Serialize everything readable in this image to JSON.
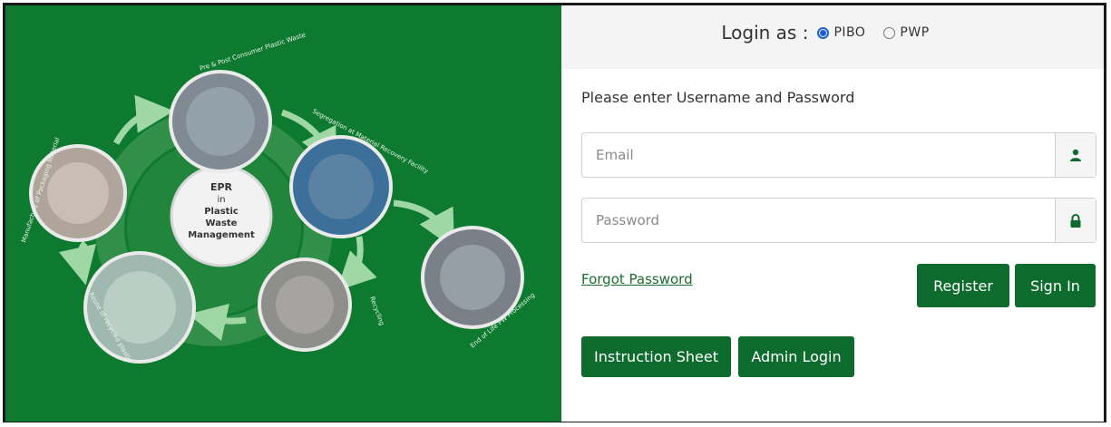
{
  "login_as": {
    "label": "Login as :",
    "options": [
      {
        "label": "PIBO",
        "checked": true
      },
      {
        "label": "PWP",
        "checked": false
      }
    ]
  },
  "instruction_text": "Please enter Username and Password",
  "email": {
    "placeholder": "Email",
    "icon": "user-icon"
  },
  "password": {
    "placeholder": "Password",
    "icon": "lock-icon"
  },
  "forgot_password": "Forgot Password",
  "buttons": {
    "register": "Register",
    "sign_in": "Sign In",
    "instruction_sheet": "Instruction Sheet",
    "admin_login": "Admin Login"
  },
  "diagram": {
    "center_text": [
      "EPR",
      "in",
      "Plastic",
      "Waste",
      "Management"
    ],
    "stages": [
      "Pre & Post Consumer Plastic Waste",
      "Segregation at Material Recovery Facility",
      "End of Life PW Processing",
      "Recycling",
      "Reuse of recycled plastic",
      "Manufacture of Packaging Material"
    ]
  },
  "colors": {
    "brand_green": "#0e7a2f",
    "button_green": "#0d6b2d",
    "radio_accent": "#1f5fd6"
  }
}
